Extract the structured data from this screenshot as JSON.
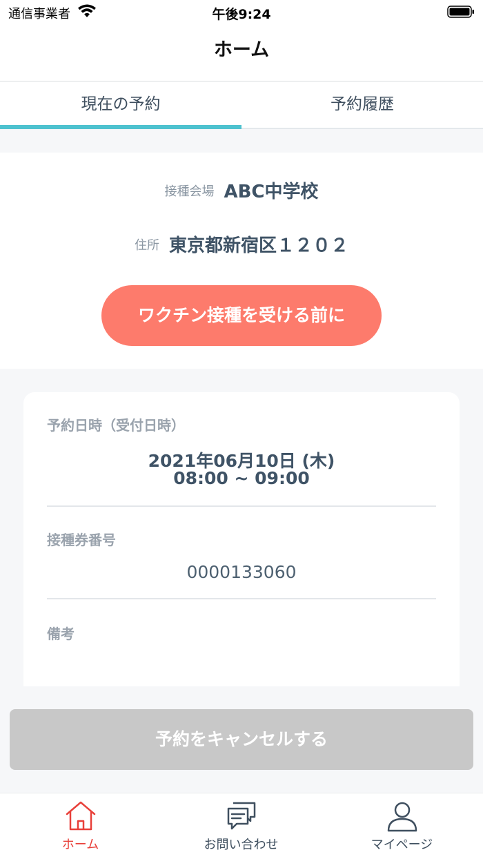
{
  "status_bar": {
    "carrier": "通信事業者",
    "time": "午後9:24"
  },
  "header": {
    "title": "ホーム"
  },
  "tabs": [
    {
      "label": "現在の予約",
      "active": true
    },
    {
      "label": "予約履歴",
      "active": false
    }
  ],
  "venue": {
    "venue_label": "接種会場",
    "venue_value": "ABC中学校",
    "address_label": "住所",
    "address_value": "東京都新宿区１２０２",
    "vaccine_button": "ワクチン接種を受ける前に"
  },
  "reservation": {
    "datetime_label": "予約日時（受付日時）",
    "date": "2021年06月10日 (木)",
    "time": "08:00 ~ 09:00",
    "ticket_label": "接種券番号",
    "ticket_number": "0000133060",
    "notes_label": "備考"
  },
  "cancel_button": "予約をキャンセルする",
  "bottom_nav": [
    {
      "label": "ホーム",
      "icon": "home-icon",
      "active": true
    },
    {
      "label": "お問い合わせ",
      "icon": "chat-icon",
      "active": false
    },
    {
      "label": "マイページ",
      "icon": "user-icon",
      "active": false
    }
  ],
  "colors": {
    "accent": "#4ec2cf",
    "button_coral": "#fd7b6c",
    "active_nav": "#e8403a",
    "disabled": "#c8c8c8"
  }
}
